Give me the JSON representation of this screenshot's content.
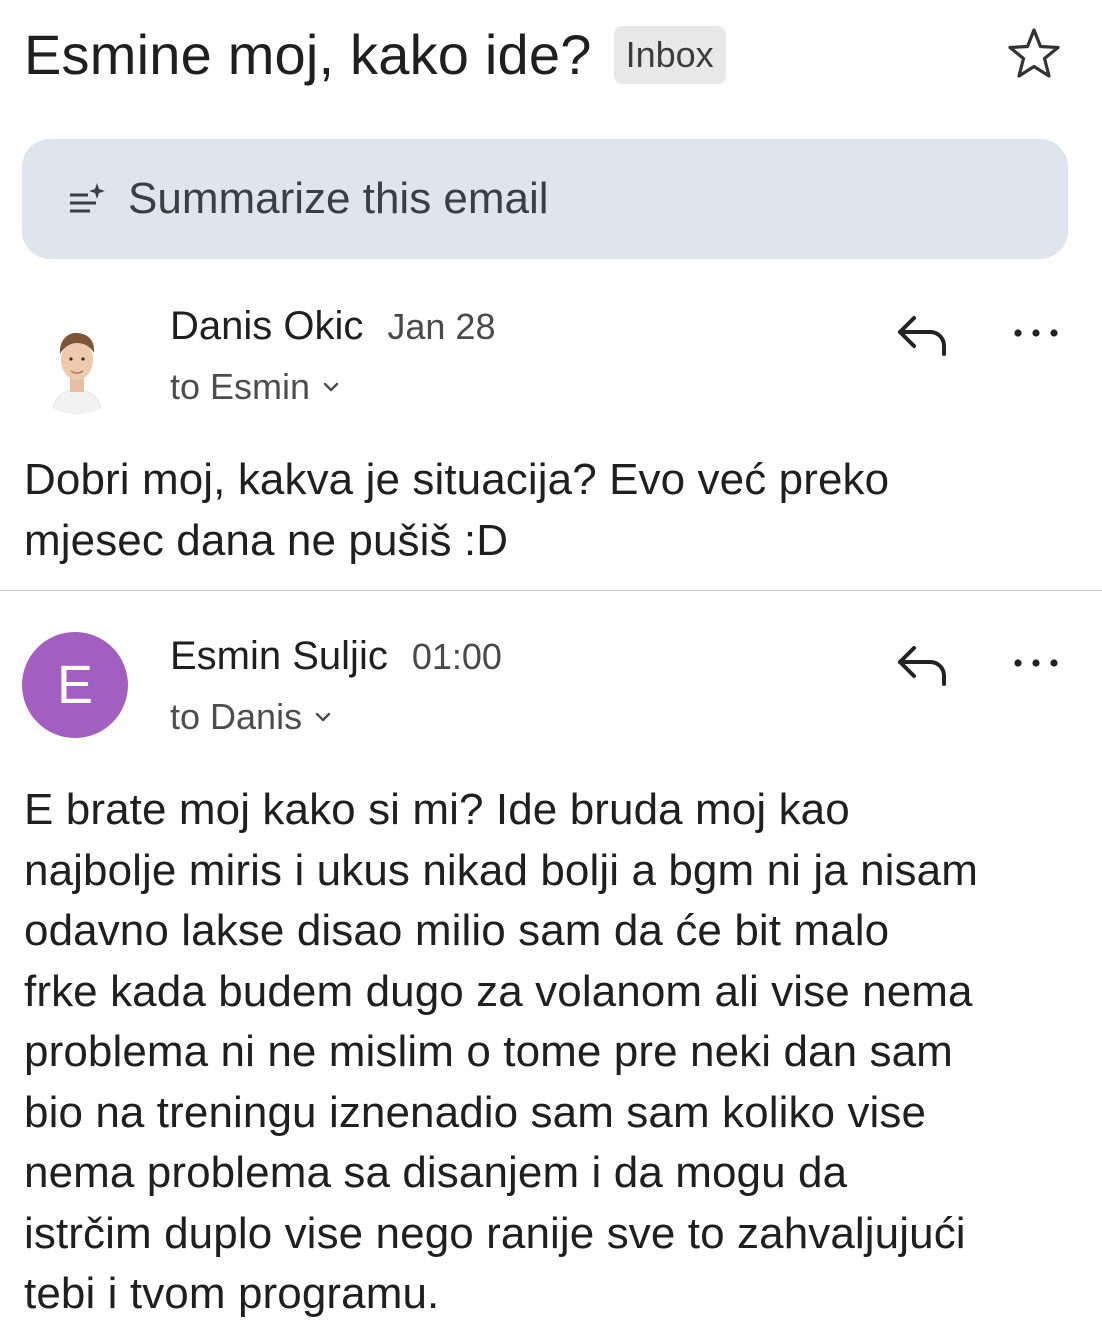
{
  "subject": "Esmine moj, kako ide?",
  "label": "Inbox",
  "summarize": {
    "label": "Summarize this email"
  },
  "messages": [
    {
      "sender": "Danis Okic",
      "date": "Jan 28",
      "to": "to Esmin",
      "avatar_icon": "person-photo",
      "body": "Dobri moj, kakva je situacija? Evo već preko\nmjesec dana ne pušiš :D"
    },
    {
      "sender": "Esmin Suljic",
      "date": "01:00",
      "to": "to Danis",
      "avatar_letter": "E",
      "avatar_color": "#a35fc0",
      "body": "E brate moj kako si mi? Ide bruda moj kao\nnajbolje miris i ukus nikad bolji a bgm ni ja nisam\nodavno  lakse disao milio sam da će bit malo\nfrke kada budem dugo za volanom ali vise nema\nproblema ni ne mislim o tome pre neki dan sam\nbio na treningu iznenadio sam sam koliko vise\nnema problema sa disanjem i da mogu da\nistrčim duplo vise nego ranije sve to zahvaljujući\ntebi i tvom programu."
    }
  ],
  "icons": {
    "star": "star-outline-icon",
    "summarize": "sparkle-list-icon",
    "reply": "reply-arrow-icon",
    "more": "more-horizontal-icon",
    "chevron": "chevron-down-icon"
  }
}
